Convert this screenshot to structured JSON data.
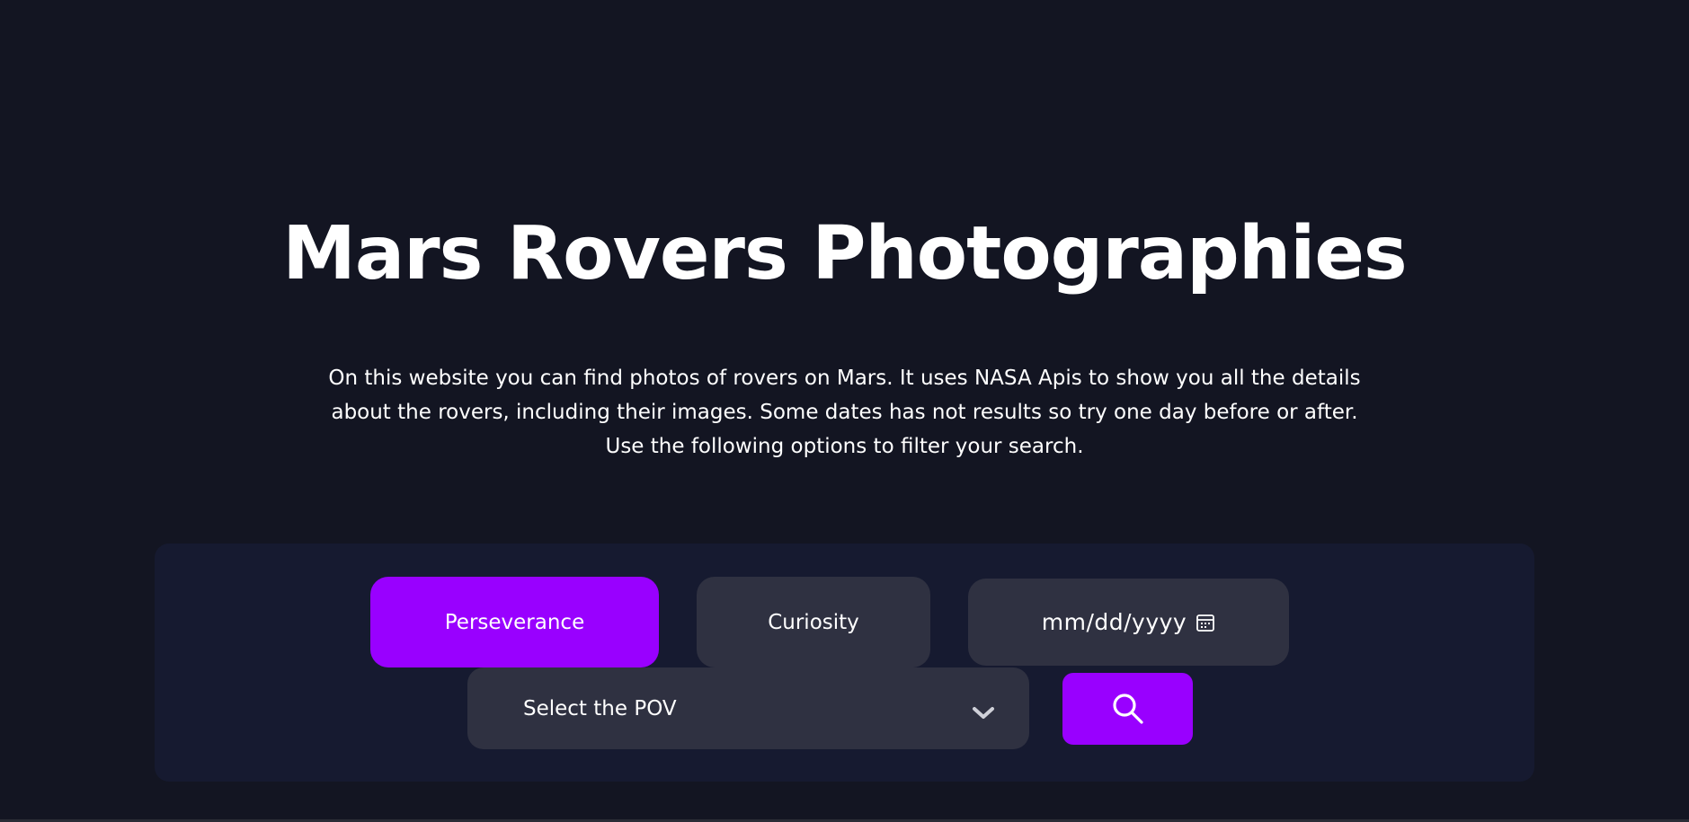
{
  "header": {
    "title": "Mars Rovers Photographies",
    "description": "On this website you can find photos of rovers on Mars. It uses NASA Apis to show you all the details about the rovers, including their images. Some dates has not results so try one day before or after. Use the following options to filter your search."
  },
  "filters": {
    "rovers": [
      {
        "label": "Perseverance",
        "selected": true
      },
      {
        "label": "Curiosity",
        "selected": false
      }
    ],
    "date": {
      "placeholder": "mm/dd/yyyy",
      "icon": "calendar-icon"
    },
    "pov": {
      "placeholder": "Select the POV",
      "icon": "chevron-down-icon"
    },
    "search": {
      "icon": "search-icon"
    }
  },
  "colors": {
    "background": "#131522",
    "panel": "#161a30",
    "accent": "#9900ff",
    "control": "#2f3141",
    "text": "#ffffff"
  }
}
